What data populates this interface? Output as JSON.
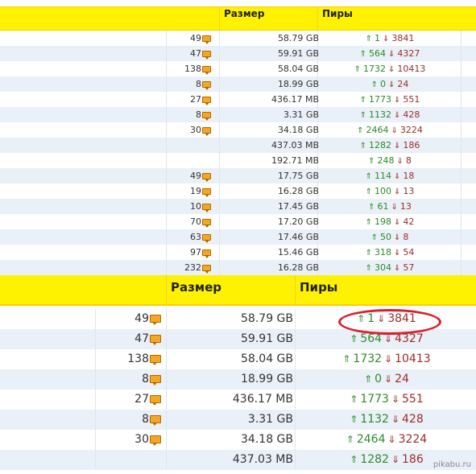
{
  "top_table": {
    "header": {
      "size_label": "Размер",
      "peers_label": "Пиры"
    },
    "rows": [
      {
        "comments": "49",
        "size": "58.79 GB",
        "seeds": "1",
        "leechers": "3841"
      },
      {
        "comments": "47",
        "size": "59.91 GB",
        "seeds": "564",
        "leechers": "4327"
      },
      {
        "comments": "138",
        "size": "58.04 GB",
        "seeds": "1732",
        "leechers": "10413"
      },
      {
        "comments": "8",
        "size": "18.99 GB",
        "seeds": "0",
        "leechers": "24"
      },
      {
        "comments": "27",
        "size": "436.17 MB",
        "seeds": "1773",
        "leechers": "551"
      },
      {
        "comments": "8",
        "size": "3.31 GB",
        "seeds": "1132",
        "leechers": "428"
      },
      {
        "comments": "30",
        "size": "34.18 GB",
        "seeds": "2464",
        "leechers": "3224"
      },
      {
        "comments": "",
        "size": "437.03 MB",
        "seeds": "1282",
        "leechers": "186"
      },
      {
        "comments": "",
        "size": "192.71 MB",
        "seeds": "248",
        "leechers": "8"
      },
      {
        "comments": "49",
        "size": "17.75 GB",
        "seeds": "114",
        "leechers": "18"
      },
      {
        "comments": "19",
        "size": "16.28 GB",
        "seeds": "100",
        "leechers": "13"
      },
      {
        "comments": "10",
        "size": "17.45 GB",
        "seeds": "61",
        "leechers": "13"
      },
      {
        "comments": "70",
        "size": "17.20 GB",
        "seeds": "198",
        "leechers": "42"
      },
      {
        "comments": "63",
        "size": "17.46 GB",
        "seeds": "50",
        "leechers": "8"
      },
      {
        "comments": "97",
        "size": "15.46 GB",
        "seeds": "318",
        "leechers": "54"
      },
      {
        "comments": "232",
        "size": "16.28 GB",
        "seeds": "304",
        "leechers": "57"
      }
    ]
  },
  "bottom_table": {
    "header": {
      "size_label": "Размер",
      "peers_label": "Пиры"
    },
    "rows": [
      {
        "comments": "49",
        "size": "58.79 GB",
        "seeds": "1",
        "leechers": "3841"
      },
      {
        "comments": "47",
        "size": "59.91 GB",
        "seeds": "564",
        "leechers": "4327"
      },
      {
        "comments": "138",
        "size": "58.04 GB",
        "seeds": "1732",
        "leechers": "10413"
      },
      {
        "comments": "8",
        "size": "18.99 GB",
        "seeds": "0",
        "leechers": "24"
      },
      {
        "comments": "27",
        "size": "436.17 MB",
        "seeds": "1773",
        "leechers": "551"
      },
      {
        "comments": "8",
        "size": "3.31 GB",
        "seeds": "1132",
        "leechers": "428"
      },
      {
        "comments": "30",
        "size": "34.18 GB",
        "seeds": "2464",
        "leechers": "3224"
      },
      {
        "comments": "",
        "size": "437.03 MB",
        "seeds": "1282",
        "leechers": "186"
      }
    ]
  },
  "seed_arrow": "⇑",
  "leech_arrow": "⇓",
  "watermark": "pikabu.ru",
  "colors": {
    "header_yellow": "#fff200",
    "row_alt": "#eaf0f7",
    "seed_green": "#2a8a2a",
    "leech_red": "#9c2b2b",
    "highlight_oval": "#d9202a"
  },
  "icons": {
    "comment": "comment-icon",
    "seed": "arrow-up-icon",
    "leech": "arrow-down-icon"
  }
}
